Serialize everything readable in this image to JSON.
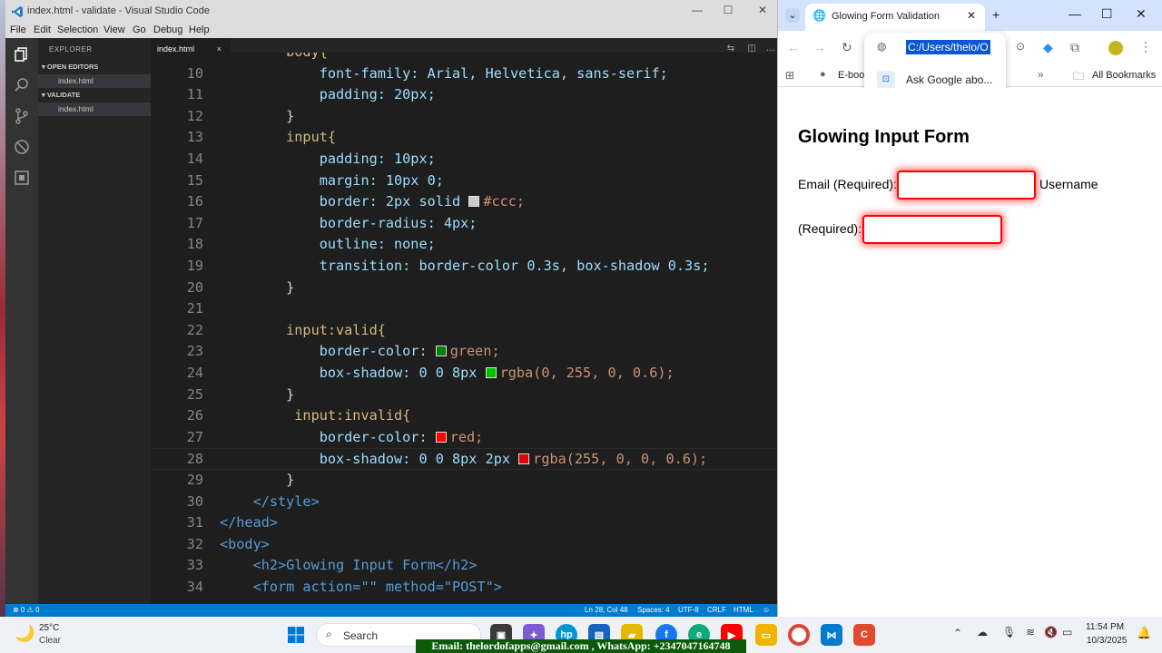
{
  "vscode": {
    "title": "index.html - validate - Visual Studio Code",
    "menu": [
      "File",
      "Edit",
      "Selection",
      "View",
      "Go",
      "Debug",
      "Help"
    ],
    "explorer_heading": "EXPLORER",
    "open_editors_label": "OPEN EDITORS",
    "open_editor_file": "index.html",
    "folder_label": "VALIDATE",
    "folder_file": "index.html",
    "active_tab": "index.html",
    "tab_close": "×",
    "status": {
      "problems": "⊗ 0 ⚠ 0",
      "position": "Ln 28, Col 48",
      "spaces": "Spaces: 4",
      "encoding": "UTF-8",
      "eol": "CRLF",
      "language": "HTML"
    }
  },
  "code_lines": [
    {
      "n": "",
      "t": "        body{"
    },
    {
      "n": "10",
      "t": "            font-family: Arial, Helvetica, sans-serif;"
    },
    {
      "n": "11",
      "t": "            padding: 20px;"
    },
    {
      "n": "12",
      "t": "        }"
    },
    {
      "n": "13",
      "t": "        input{"
    },
    {
      "n": "14",
      "t": "            padding: 10px;"
    },
    {
      "n": "15",
      "t": "            margin: 10px 0;"
    },
    {
      "n": "16",
      "t": "            border: 2px solid ",
      "swatch": "#cccccc",
      "rest": "#ccc;"
    },
    {
      "n": "17",
      "t": "            border-radius: 4px;"
    },
    {
      "n": "18",
      "t": "            outline: none;"
    },
    {
      "n": "19",
      "t": "            transition: border-color 0.3s, box-shadow 0.3s;"
    },
    {
      "n": "20",
      "t": "        }"
    },
    {
      "n": "21",
      "t": ""
    },
    {
      "n": "22",
      "t": "        input:valid{"
    },
    {
      "n": "23",
      "t": "            border-color: ",
      "swatch": "#008000",
      "rest": "green;"
    },
    {
      "n": "24",
      "t": "            box-shadow: 0 0 8px ",
      "swatch": "#00c000",
      "rest": "rgba(0, 255, 0, 0.6);"
    },
    {
      "n": "25",
      "t": "        }"
    },
    {
      "n": "26",
      "t": "         input:invalid{"
    },
    {
      "n": "27",
      "t": "            border-color: ",
      "swatch": "#ff0000",
      "rest": "red;"
    },
    {
      "n": "28",
      "t": "            box-shadow: 0 0 8px 2px ",
      "swatch": "#e00000",
      "rest": "rgba(255, 0, 0, 0.6);"
    },
    {
      "n": "29",
      "t": "        }"
    },
    {
      "n": "30",
      "t": "    </style>"
    },
    {
      "n": "31",
      "t": "</head>"
    },
    {
      "n": "32",
      "t": "<body>"
    },
    {
      "n": "33",
      "t": "    <h2>Glowing Input Form</h2>"
    },
    {
      "n": "34",
      "t": "    <form action=\"\" method=\"POST\">"
    }
  ],
  "chrome": {
    "tab_title": "Glowing Form Validation",
    "url": "C:/Users/thelo/O",
    "suggestion": "Ask Google abo...",
    "bookmark": "E-book",
    "all_bookmarks": "All Bookmarks"
  },
  "page": {
    "heading": "Glowing Input Form",
    "email_label": "Email (Required):",
    "username_label": "Username",
    "required_label": "(Required):"
  },
  "taskbar": {
    "temp": "25°C",
    "weather": "Clear",
    "search": "Search",
    "time": "11:54 PM",
    "date": "10/3/2025",
    "banner": "Email: thelordofapps@gmail.com , WhatsApp: +2347047164748"
  },
  "colors": {
    "vscode_blue": "#007acc",
    "invalid_red": "#ff0000",
    "selection_blue": "#0b57d0"
  }
}
